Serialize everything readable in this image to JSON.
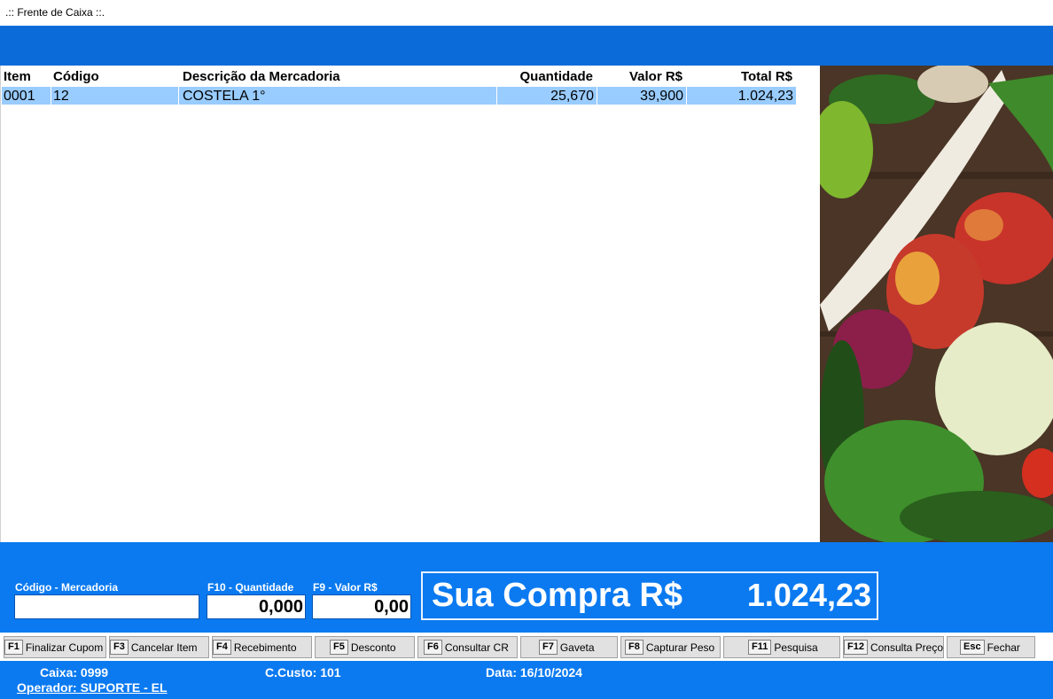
{
  "window": {
    "title": ".:: Frente de Caixa ::."
  },
  "table": {
    "columns": [
      "Item",
      "Código",
      "Descrição da Mercadoria",
      "Quantidade",
      "Valor R$",
      "Total R$"
    ],
    "rows": [
      {
        "item": "0001",
        "codigo": "12",
        "descricao": "COSTELA 1°",
        "quantidade": "25,670",
        "valor": "39,900",
        "total": "1.024,23"
      }
    ]
  },
  "entry": {
    "codigo_label": "Código - Mercadoria",
    "codigo_value": "",
    "quantidade_label": "F10 - Quantidade",
    "quantidade_value": "0,000",
    "valor_label": "F9 - Valor R$",
    "valor_value": "0,00"
  },
  "total": {
    "label": "Sua Compra R$",
    "value": "1.024,23"
  },
  "fkeys": [
    {
      "key": "F1",
      "label": "Finalizar Cupom"
    },
    {
      "key": "F3",
      "label": "Cancelar Item"
    },
    {
      "key": "F4",
      "label": "Recebimento"
    },
    {
      "key": "F5",
      "label": "Desconto"
    },
    {
      "key": "F6",
      "label": "Consultar CR"
    },
    {
      "key": "F7",
      "label": "Gaveta"
    },
    {
      "key": "F8",
      "label": "Capturar Peso"
    },
    {
      "key": "F11",
      "label": "Pesquisa"
    },
    {
      "key": "F12",
      "label": "Consulta Preço"
    },
    {
      "key": "Esc",
      "label": "Fechar"
    }
  ],
  "status": {
    "caixa": "Caixa: 0999",
    "ccusto": "C.Custo: 101",
    "data": "Data: 16/10/2024",
    "operador": "Operador: SUPORTE - EL"
  },
  "colors": {
    "primary_blue": "#0b7af0",
    "header_blue": "#0b6cd9",
    "row_highlight": "#99ccff"
  }
}
